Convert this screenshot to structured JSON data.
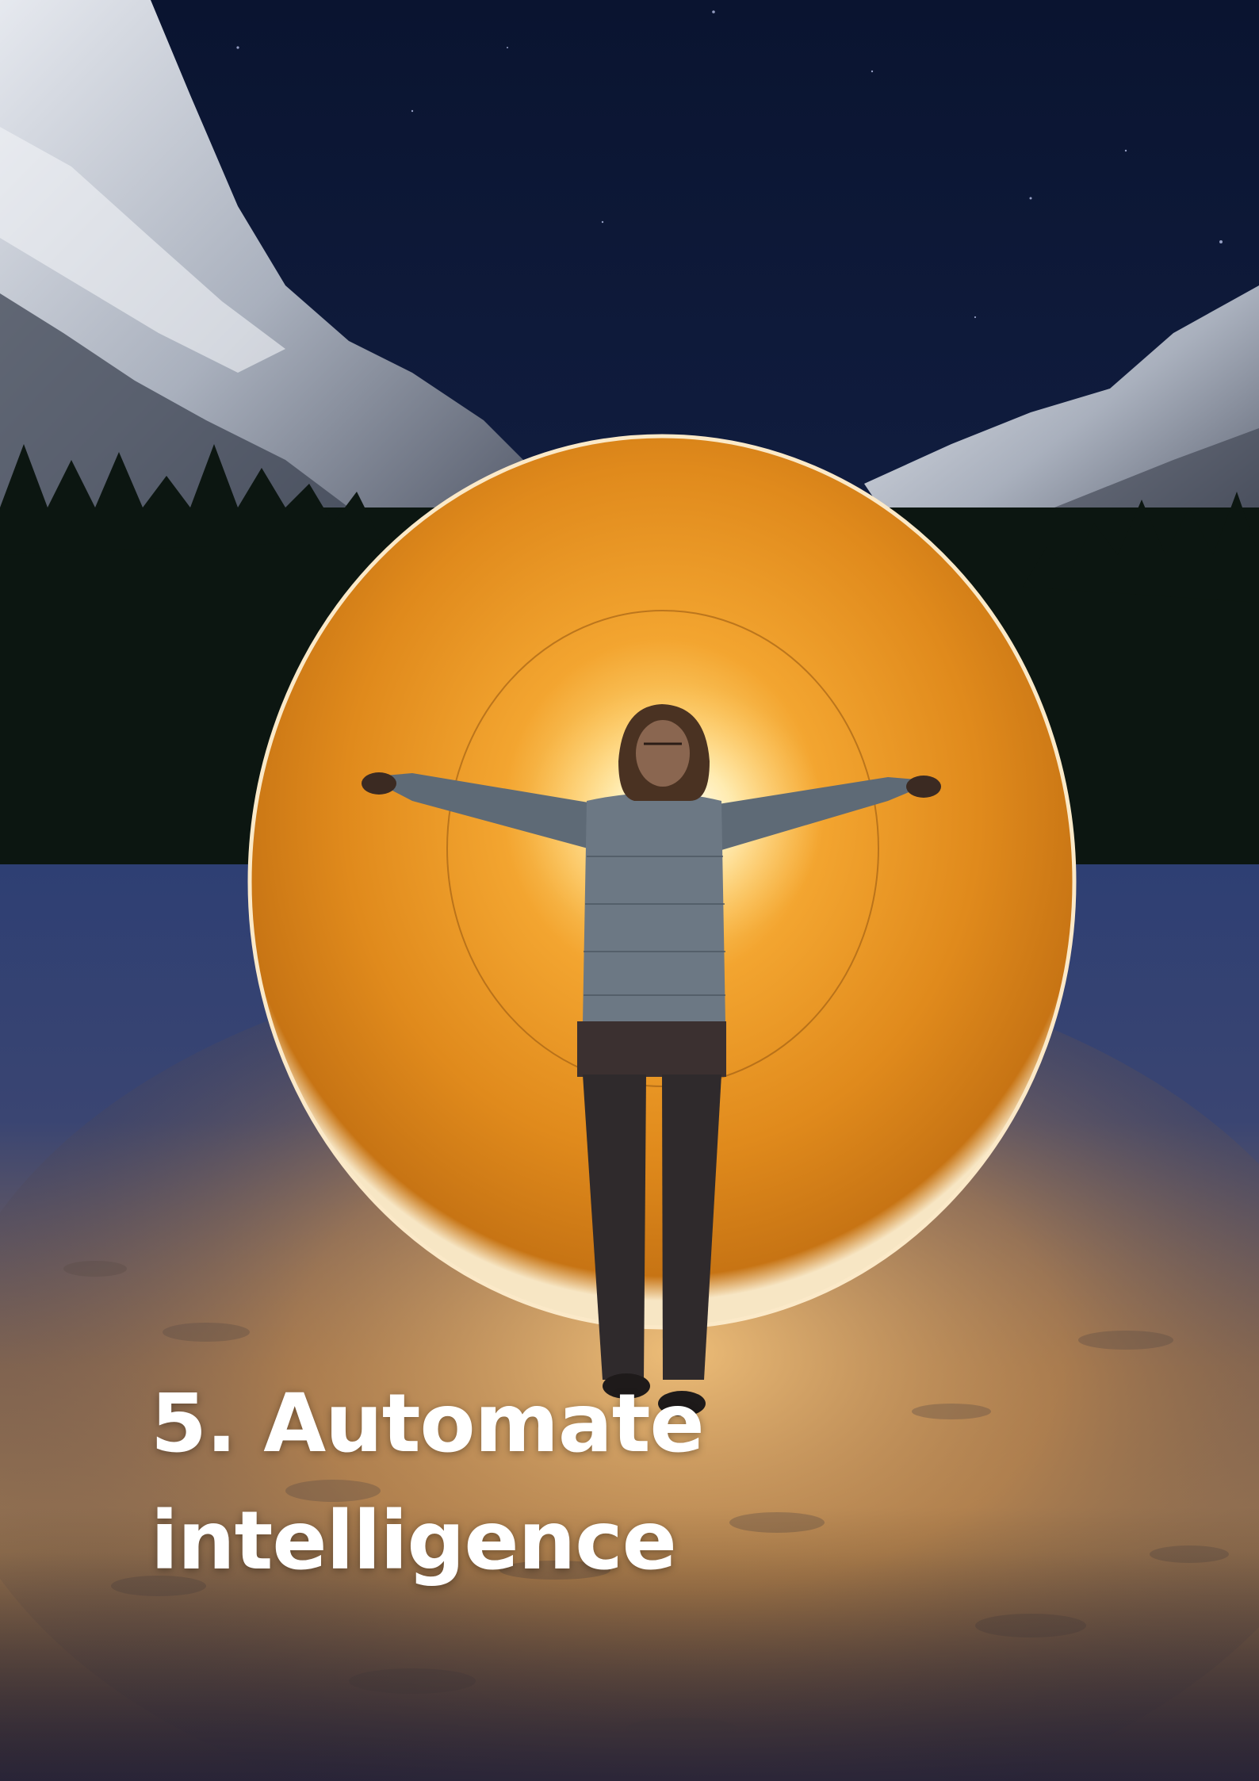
{
  "heading": {
    "line1": "5. Automate",
    "line2": "intelligence"
  },
  "photo": {
    "subject": "person-with-outstretched-arms-inside-light-painted-orb",
    "colors": {
      "sky": "#0d1838",
      "orb": "#e58a1a",
      "orb_core": "#fff3c8",
      "snow_lit": "#b78a55",
      "snow_shadow": "#3a4a78",
      "text": "#ffffff"
    }
  }
}
